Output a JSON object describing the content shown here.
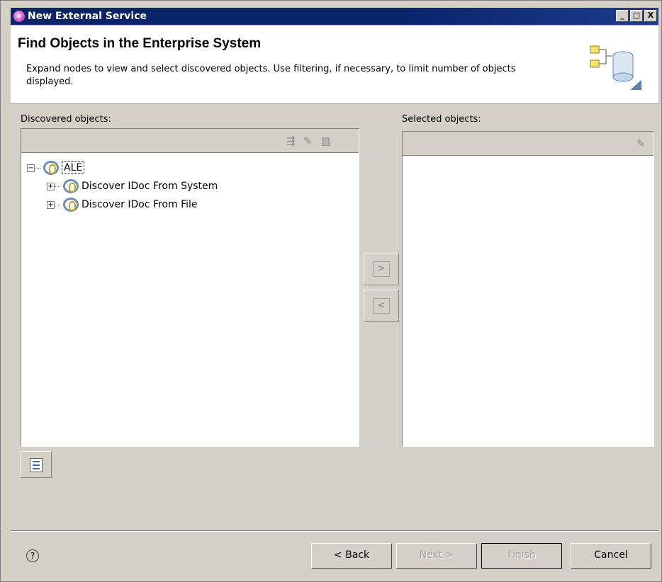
{
  "window": {
    "title": "New External Service",
    "controls": {
      "minimize": "_",
      "maximize": "□",
      "close": "X"
    }
  },
  "header": {
    "title": "Find Objects in the Enterprise System",
    "description": "Expand nodes to view and select discovered objects.  Use filtering, if necessary, to limit number of objects displayed."
  },
  "discovered": {
    "label": "Discovered objects:",
    "toolbar_icons": [
      "filter-icon",
      "edit-icon",
      "book-icon"
    ],
    "tree": [
      {
        "label": "ALE",
        "expander": "−",
        "level": 0
      },
      {
        "label": "Discover IDoc From System",
        "expander": "+",
        "level": 1
      },
      {
        "label": "Discover IDoc From File",
        "expander": "+",
        "level": 1
      }
    ]
  },
  "selected": {
    "label": "Selected objects:",
    "toolbar_icons": [
      "edit-icon"
    ]
  },
  "transfer": {
    "add_glyph": ">",
    "remove_glyph": "<"
  },
  "footer": {
    "help_glyph": "?",
    "back": "< Back",
    "next": "Next >",
    "finish": "Finish",
    "cancel": "Cancel"
  }
}
